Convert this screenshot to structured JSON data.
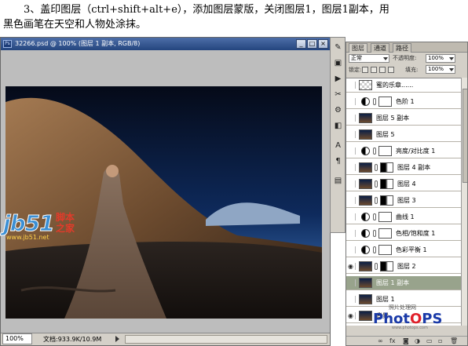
{
  "caption": {
    "line1": "3、盖印图层（ctrl+shift+alt+e），添加图层蒙版，关闭图层1，图层1副本，用",
    "line2": "黑色画笔在天空和人物处涂抹。"
  },
  "document": {
    "title": "32266.psd @ 100% (图层 1 副本, RGB/8)",
    "zoom": "100%",
    "doc_size": "文档:933.9K/10.9M"
  },
  "panel": {
    "tabs": [
      "图层",
      "通道",
      "路径"
    ],
    "blend_mode": "正常",
    "opacity_label": "不透明度:",
    "opacity_value": "100%",
    "lock_label": "锁定:",
    "fill_label": "填充:",
    "fill_value": "100%",
    "layers": [
      {
        "name": "蜜的乐章......",
        "type": "text",
        "visible": false,
        "selected": false
      },
      {
        "name": "色阶 1",
        "type": "adjustment",
        "visible": false,
        "selected": false
      },
      {
        "name": "图层 5 副本",
        "type": "pixel",
        "visible": false,
        "selected": false
      },
      {
        "name": "图层 5",
        "type": "pixel",
        "visible": false,
        "selected": false
      },
      {
        "name": "亮度/对比度 1",
        "type": "adjustment",
        "visible": false,
        "selected": false
      },
      {
        "name": "图层 4 副本",
        "type": "masked",
        "visible": false,
        "selected": false
      },
      {
        "name": "图层 4",
        "type": "masked",
        "visible": false,
        "selected": false
      },
      {
        "name": "图层 3",
        "type": "masked",
        "visible": false,
        "selected": false
      },
      {
        "name": "曲线 1",
        "type": "adjustment",
        "visible": false,
        "selected": false
      },
      {
        "name": "色相/饱和度 1",
        "type": "adjustment",
        "visible": false,
        "selected": false
      },
      {
        "name": "色彩平衡 1",
        "type": "adjustment",
        "visible": false,
        "selected": false
      },
      {
        "name": "图层 2",
        "type": "masked",
        "visible": true,
        "selected": false
      },
      {
        "name": "图层 1 副本",
        "type": "pixel",
        "visible": false,
        "selected": true
      },
      {
        "name": "图层 1",
        "type": "pixel",
        "visible": false,
        "selected": false
      },
      {
        "name": "背景",
        "type": "pixel",
        "visible": true,
        "selected": false
      }
    ]
  },
  "watermarks": {
    "jb51_big": "jb51",
    "jb51_cn1": "脚本",
    "jb51_cn2": "之家",
    "jb51_url": "www.jb51.net",
    "photops_small": "照片处理网",
    "photops_big_1": "Phot",
    "photops_big_2": "O",
    "photops_big_3": "PS",
    "photops_url": "www.photops.com"
  }
}
